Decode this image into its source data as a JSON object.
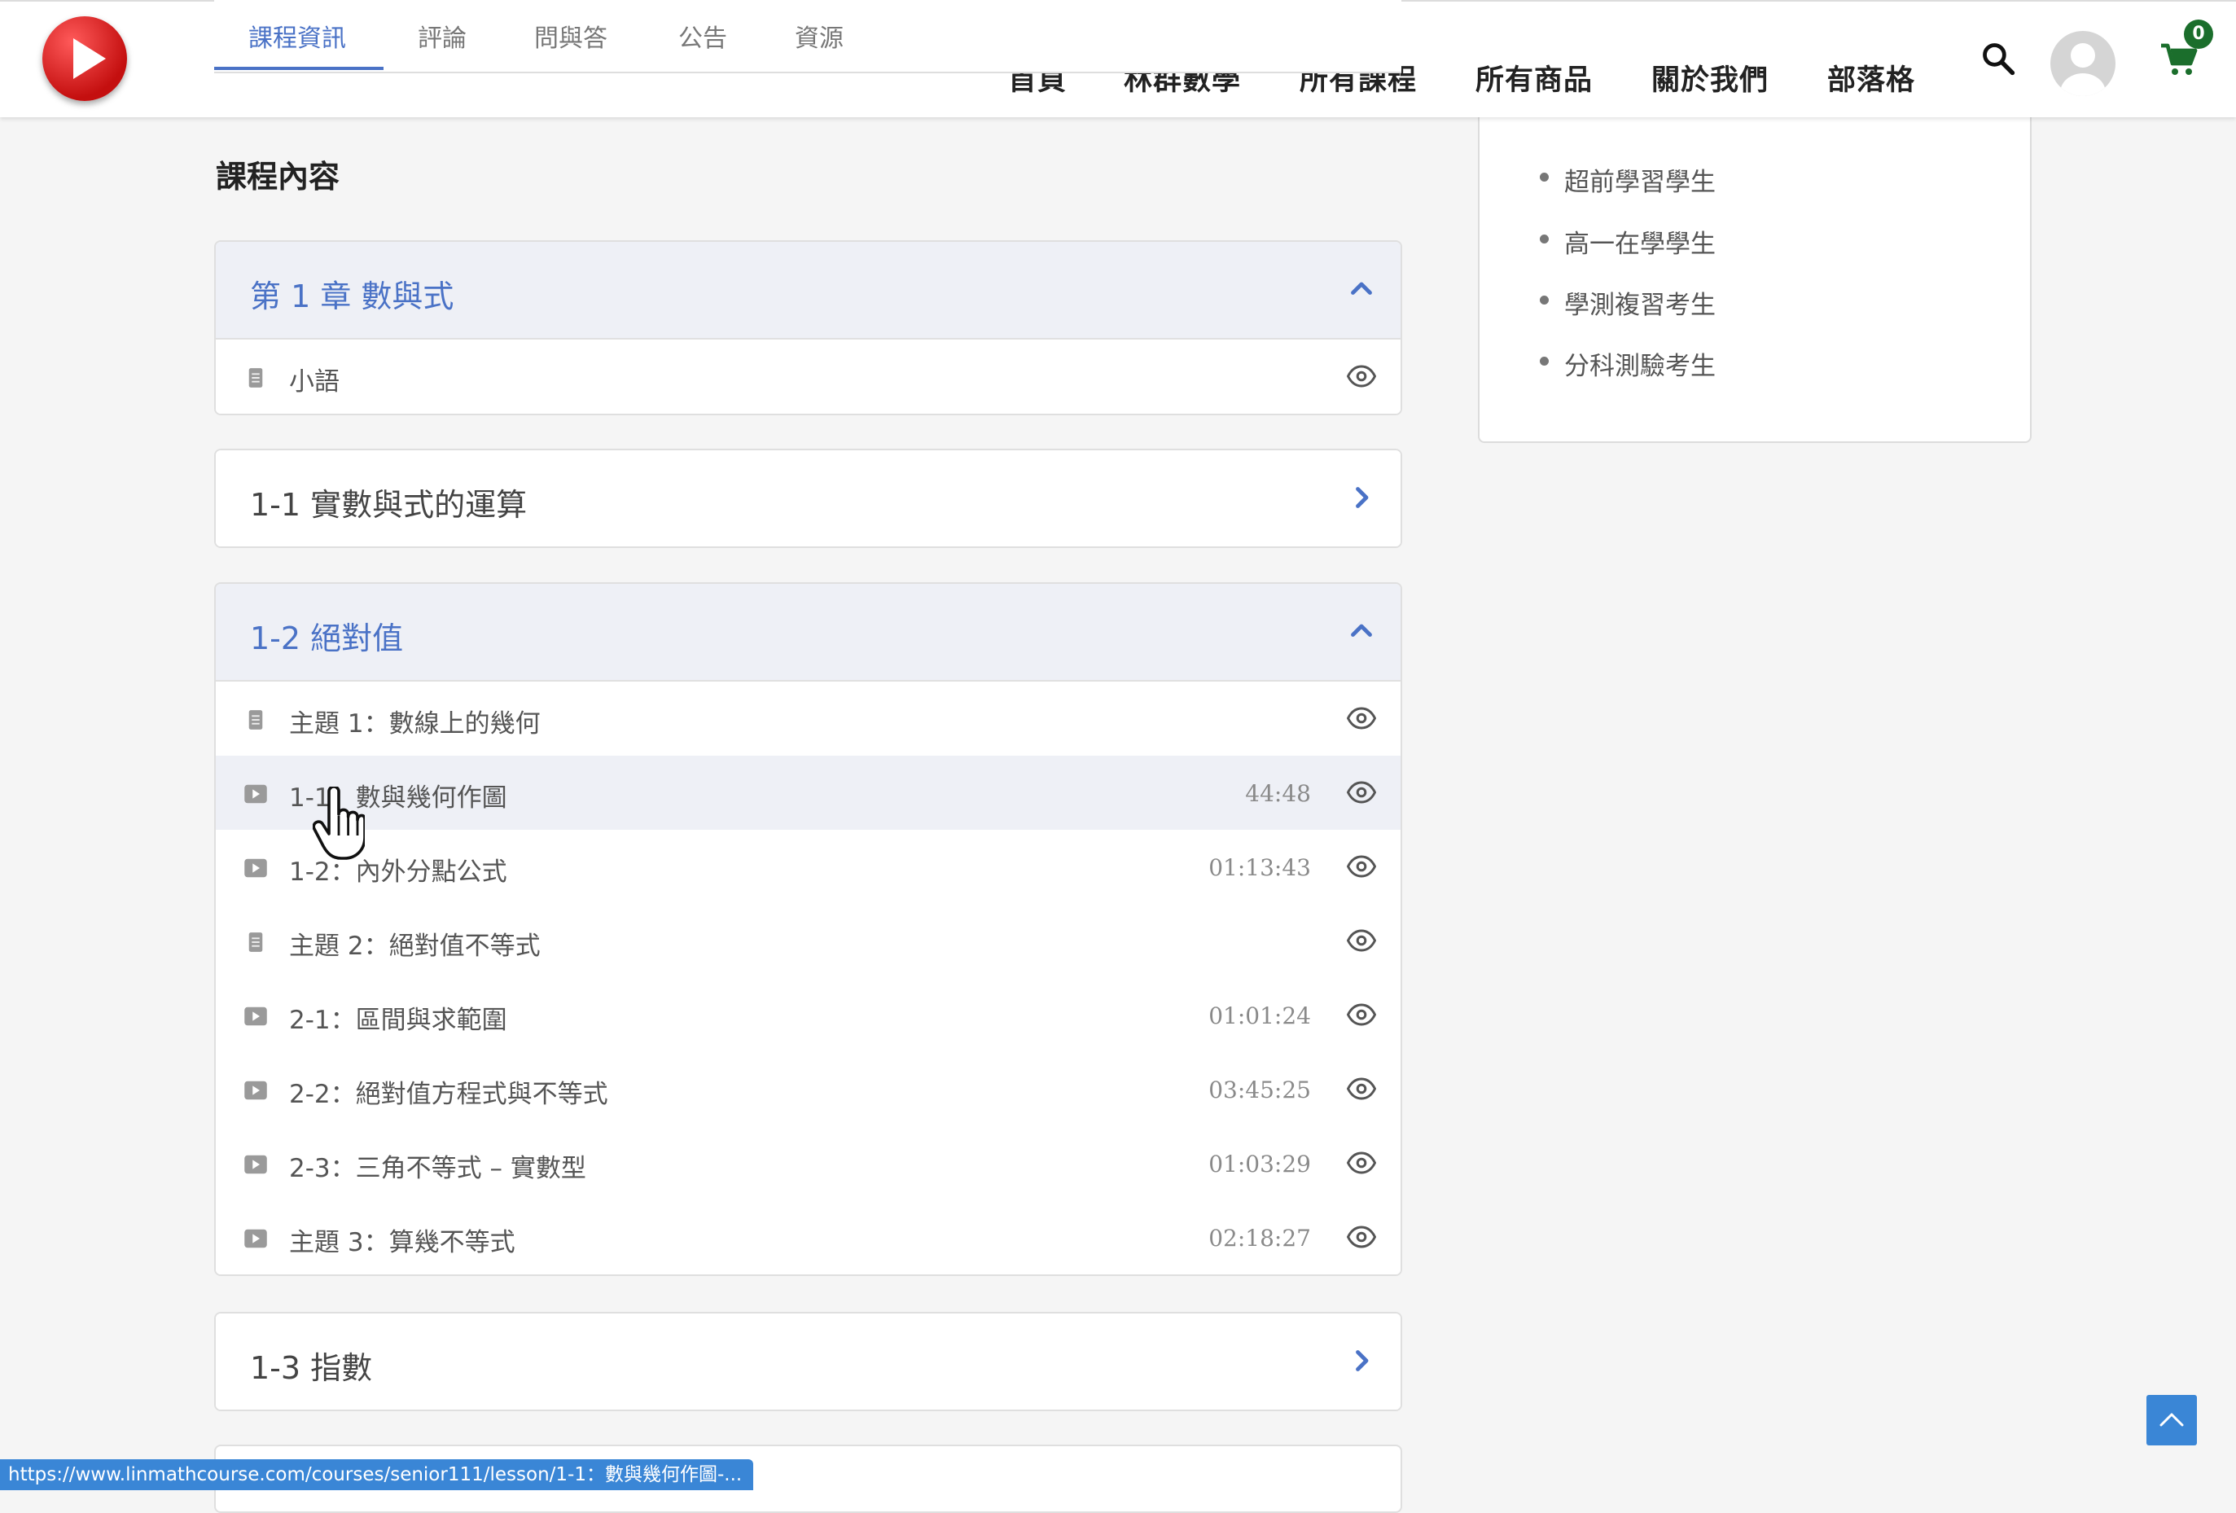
{
  "nav": {
    "items": [
      "首頁",
      "林群數學",
      "所有課程",
      "所有商品",
      "關於我們",
      "部落格"
    ],
    "cart_count": "0"
  },
  "tabs": [
    "課程資訊",
    "評論",
    "問與答",
    "公告",
    "資源"
  ],
  "active_tab": "課程資訊",
  "section_title": "課程內容",
  "sidebar": {
    "audience": [
      "超前學習學生",
      "高一在學學生",
      "學測複習考生",
      "分科測驗考生"
    ]
  },
  "chapters": [
    {
      "title": "第 1 章 數與式",
      "expanded": true,
      "lessons": [
        {
          "title": "小語",
          "type": "document",
          "duration": ""
        }
      ]
    },
    {
      "title": "1-1 實數與式的運算",
      "expanded": false
    },
    {
      "title": "1-2 絕對值",
      "expanded": true,
      "lessons": [
        {
          "title": "主題 1：數線上的幾何",
          "type": "document",
          "duration": ""
        },
        {
          "title": "1-1：數與幾何作圖",
          "type": "video",
          "duration": "44:48"
        },
        {
          "title": "1-2：內外分點公式",
          "type": "video",
          "duration": "01:13:43"
        },
        {
          "title": "主題 2：絕對值不等式",
          "type": "document",
          "duration": ""
        },
        {
          "title": "2-1：區間與求範圍",
          "type": "video",
          "duration": "01:01:24"
        },
        {
          "title": "2-2：絕對值方程式與不等式",
          "type": "video",
          "duration": "03:45:25"
        },
        {
          "title": "2-3：三角不等式 – 實數型",
          "type": "video",
          "duration": "01:03:29"
        },
        {
          "title": "主題 3：算幾不等式",
          "type": "video",
          "duration": "02:18:27"
        }
      ]
    },
    {
      "title": "1-3 指數",
      "expanded": false
    }
  ],
  "status_url": "https://www.linmathcourse.com/courses/senior111/lesson/1-1：數與幾何作圖-...",
  "colors": {
    "accent": "#4a72c6",
    "open_header_bg": "#eef0f6",
    "status_bar": "#3a86d6",
    "cart": "#1b6e2c"
  },
  "icons": [
    "search-icon",
    "user-avatar-icon",
    "cart-icon",
    "chevron-up-icon",
    "chevron-right-icon",
    "document-icon",
    "video-icon",
    "eye-icon",
    "arrow-up-icon",
    "hand-cursor-icon"
  ]
}
